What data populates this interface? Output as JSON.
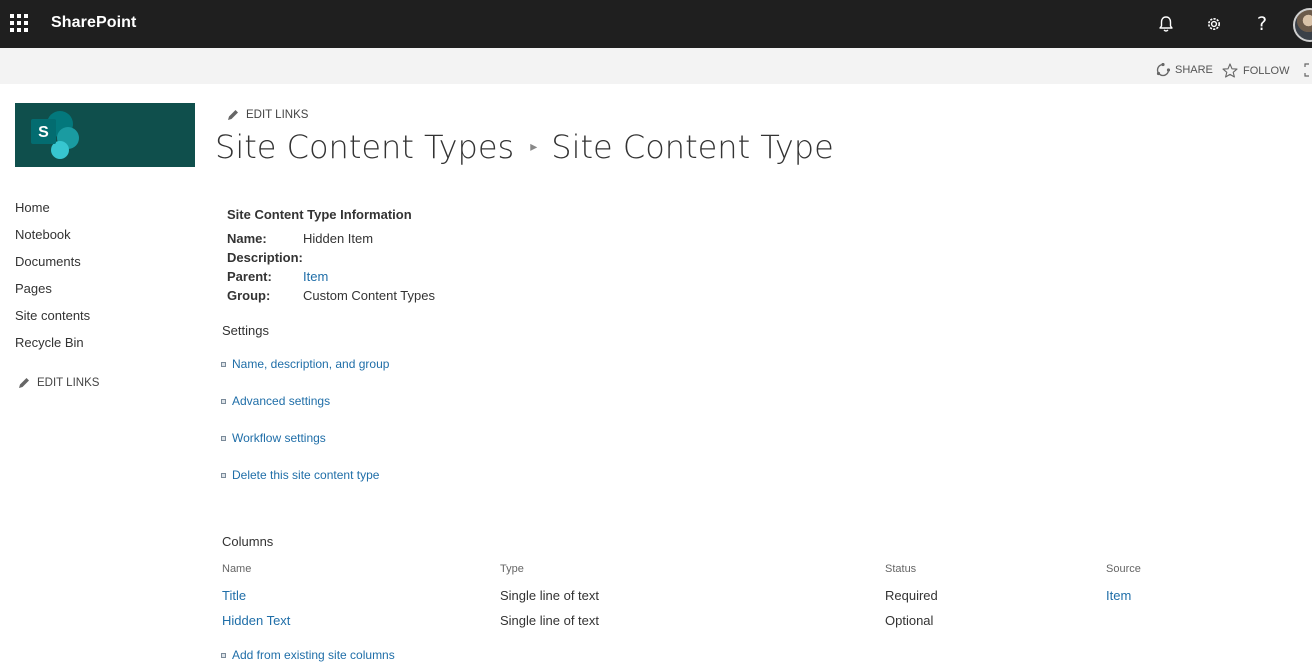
{
  "suite": {
    "brand": "SharePoint",
    "icons": [
      "app-launcher-icon",
      "bell-icon",
      "gear-icon",
      "help-icon"
    ],
    "help_glyph": "?"
  },
  "ribbon": {
    "share_label": "SHARE",
    "follow_label": "FOLLOW"
  },
  "logo": {
    "letter": "S",
    "background_color": "#0f4f4c",
    "accent_colors": [
      "#03787c",
      "#1a9ba1",
      "#37c6d0"
    ]
  },
  "nav": {
    "items": [
      "Home",
      "Notebook",
      "Documents",
      "Pages",
      "Site contents",
      "Recycle Bin"
    ],
    "edit_links_label": "EDIT LINKS"
  },
  "header": {
    "edit_links_label": "EDIT LINKS",
    "breadcrumb": [
      "Site Content Types",
      "Site Content Type"
    ]
  },
  "info": {
    "heading": "Site Content Type Information",
    "name_label": "Name:",
    "name_value": "Hidden Item",
    "description_label": "Description:",
    "description_value": "",
    "parent_label": "Parent:",
    "parent_value": "Item",
    "group_label": "Group:",
    "group_value": "Custom Content Types"
  },
  "settings": {
    "heading": "Settings",
    "links": [
      "Name, description, and group",
      "Advanced settings",
      "Workflow settings",
      "Delete this site content type"
    ]
  },
  "columns": {
    "heading": "Columns",
    "headers": [
      "Name",
      "Type",
      "Status",
      "Source"
    ],
    "rows": [
      {
        "name": "Title",
        "type": "Single line of text",
        "status": "Required",
        "source": "Item"
      },
      {
        "name": "Hidden Text",
        "type": "Single line of text",
        "status": "Optional",
        "source": ""
      }
    ],
    "add_link": "Add from existing site columns"
  },
  "colors": {
    "suite_bar": "#1f1f1f",
    "link": "#1f6ea8",
    "ribbon": "#f3f3f3"
  }
}
